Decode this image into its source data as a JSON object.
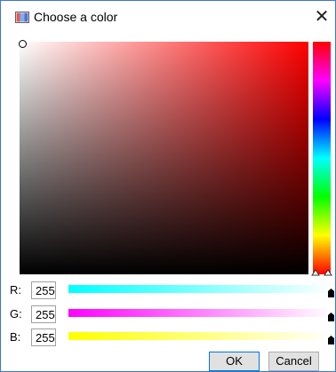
{
  "dialog": {
    "title": "Choose a color",
    "close_glyph": "✕"
  },
  "picker": {
    "hue_color": "#ff0000"
  },
  "channels": [
    {
      "label": "R:",
      "value": "255",
      "track_from": "#00ffff",
      "track_to": "#ffffff"
    },
    {
      "label": "G:",
      "value": "255",
      "track_from": "#ff00ff",
      "track_to": "#ffffff"
    },
    {
      "label": "B:",
      "value": "255",
      "track_from": "#ffff00",
      "track_to": "#ffffff"
    }
  ],
  "buttons": {
    "ok": "OK",
    "cancel": "Cancel"
  }
}
